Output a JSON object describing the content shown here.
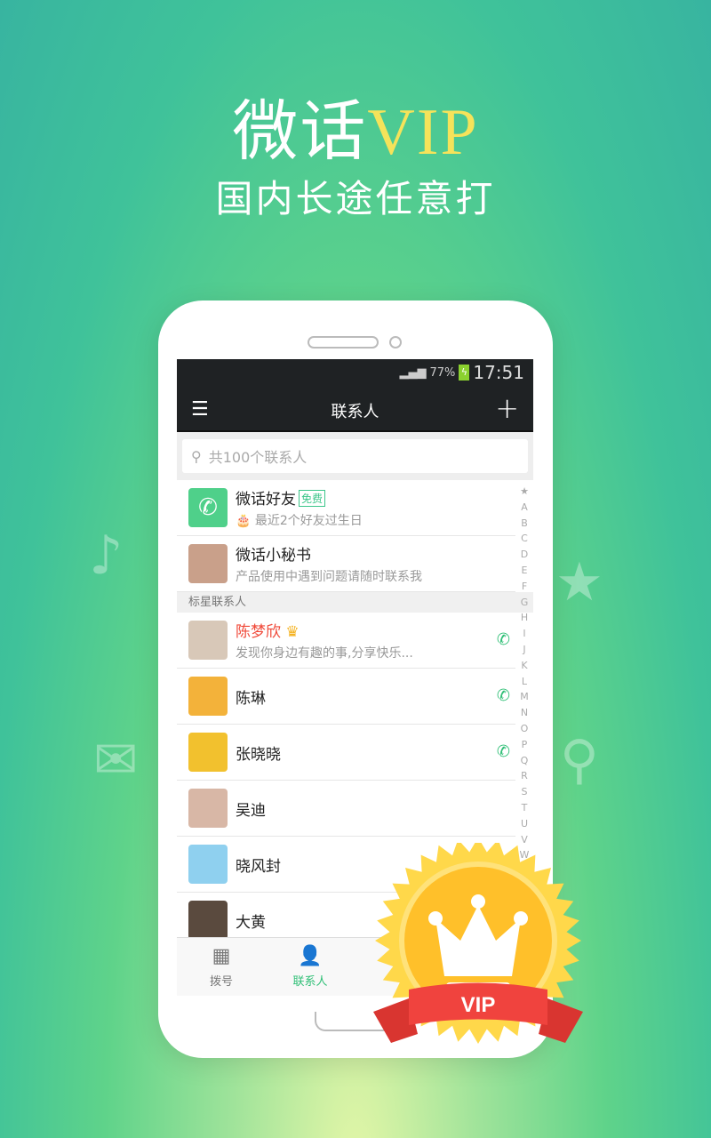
{
  "promo": {
    "brand": "微话",
    "brand_vip": "VIP",
    "tagline": "国内长途任意打"
  },
  "status_bar": {
    "battery": "77%",
    "time": "17:51"
  },
  "app_bar": {
    "title": "联系人"
  },
  "search": {
    "placeholder": "共100个联系人"
  },
  "top_items": [
    {
      "name": "微话好友",
      "badge": "免费",
      "desc": "最近2个好友过生日",
      "color": "#4fd08a"
    },
    {
      "name": "微话小秘书",
      "desc": "产品使用中遇到问题请随时联系我",
      "color": "#c9a08a"
    }
  ],
  "section_starred": "标星联系人",
  "contacts": [
    {
      "name": "陈梦欣",
      "desc": "发现你身边有趣的事,分享快乐...",
      "vip": true,
      "call": true,
      "color": "#d8c8b8"
    },
    {
      "name": "陈琳",
      "call": true,
      "color": "#f3b23a"
    },
    {
      "name": "张晓晓",
      "call": true,
      "color": "#f2c12e"
    },
    {
      "name": "吴迪",
      "color": "#d8b7a6"
    },
    {
      "name": "晓风封",
      "color": "#8fd0ef"
    },
    {
      "name": "大黄",
      "color": "#5a4a3e"
    }
  ],
  "index_letters": [
    "★",
    "A",
    "B",
    "C",
    "D",
    "E",
    "F",
    "G",
    "H",
    "I",
    "J",
    "K",
    "L",
    "M",
    "N",
    "O",
    "P",
    "Q",
    "R",
    "S",
    "T",
    "U",
    "V",
    "W"
  ],
  "tabs": [
    {
      "label": "拨号",
      "active": false
    },
    {
      "label": "联系人",
      "active": true
    }
  ],
  "seal": {
    "label": "VIP"
  },
  "colors": {
    "accent": "#2fbf76",
    "vip_name": "#f04a3a",
    "seal_gold": "#ffc830",
    "ribbon": "#f0433e"
  }
}
